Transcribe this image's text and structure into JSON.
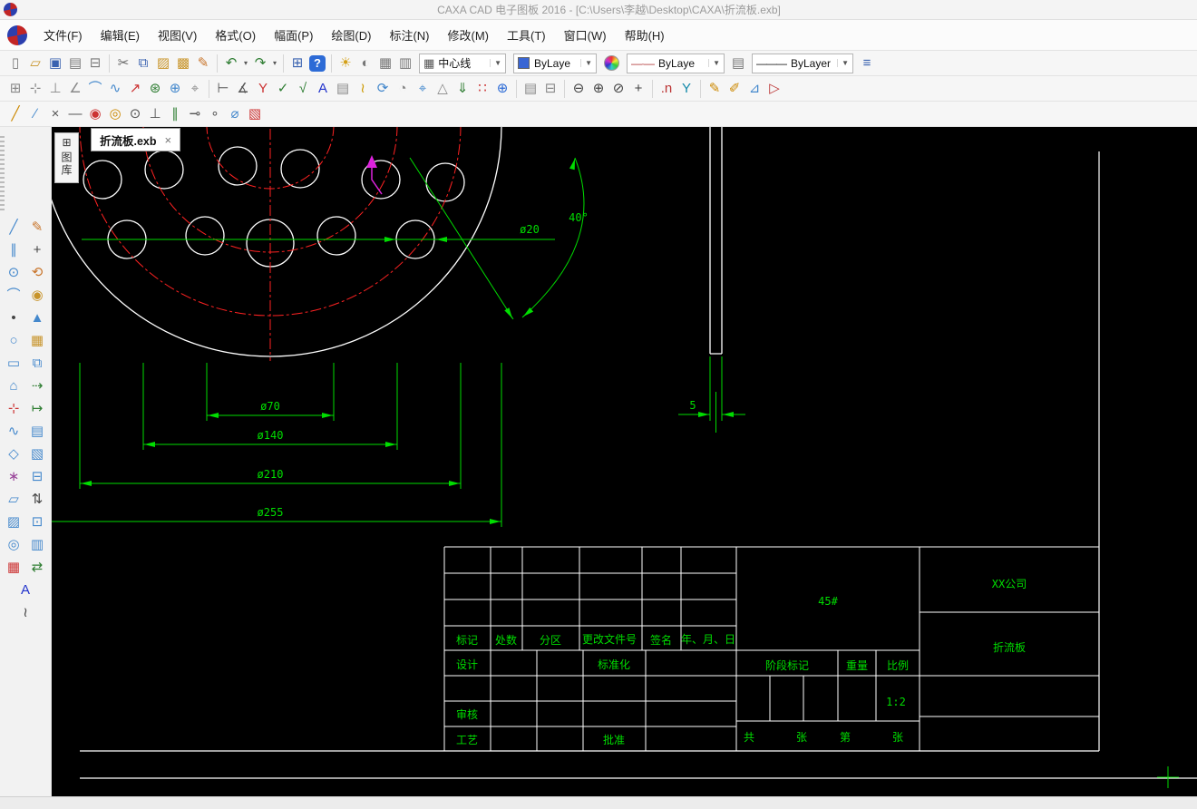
{
  "window": {
    "title": "CAXA CAD 电子图板 2016 - [C:\\Users\\李越\\Desktop\\CAXA\\折流板.exb]"
  },
  "menu": {
    "items": [
      "文件(F)",
      "编辑(E)",
      "视图(V)",
      "格式(O)",
      "幅面(P)",
      "绘图(D)",
      "标注(N)",
      "修改(M)",
      "工具(T)",
      "窗口(W)",
      "帮助(H)"
    ]
  },
  "toolbar1": {
    "layer_value": "中心线",
    "color_value": "ByLaye",
    "linetype_value": "ByLaye",
    "lineweight_value": "ByLayer",
    "linetype_glyph": "—·—",
    "lineweight_glyph": "———",
    "icons": [
      {
        "n": "new-file-icon",
        "g": "▯",
        "c": "#7a7a7a"
      },
      {
        "n": "open-file-icon",
        "g": "▱",
        "c": "#c8942a"
      },
      {
        "n": "save-icon",
        "g": "▣",
        "c": "#3a62b0"
      },
      {
        "n": "print-preview-icon",
        "g": "▤",
        "c": "#7a7a7a"
      },
      {
        "n": "print-icon",
        "g": "⊟",
        "c": "#7a7a7a"
      },
      {
        "sep": true
      },
      {
        "n": "cut-icon",
        "g": "✂",
        "c": "#666666"
      },
      {
        "n": "copy-icon",
        "g": "⧉",
        "c": "#3a62b0"
      },
      {
        "n": "paste-icon",
        "g": "▨",
        "c": "#c8942a"
      },
      {
        "n": "paste-special-icon",
        "g": "▩",
        "c": "#c8942a"
      },
      {
        "n": "format-brush-icon",
        "g": "✎",
        "c": "#c8742a"
      },
      {
        "sep": true
      },
      {
        "n": "undo-icon",
        "g": "↶",
        "c": "#2e7d32"
      },
      {
        "n": "undo-dropdown-icon",
        "g": "▾",
        "c": "#555555",
        "small": true
      },
      {
        "n": "redo-icon",
        "g": "↷",
        "c": "#2e7d32"
      },
      {
        "n": "redo-dropdown-icon",
        "g": "▾",
        "c": "#555555",
        "small": true
      },
      {
        "sep": true
      },
      {
        "n": "ole-object-icon",
        "g": "⊞",
        "c": "#3a62b0"
      },
      {
        "n": "help-icon",
        "g": "?",
        "c": "#ffffff",
        "bg": "#2d6bd6"
      }
    ],
    "layer_icons": [
      {
        "n": "layer-visibility-icon",
        "g": "☀",
        "c": "#d4a017"
      },
      {
        "n": "layer-state-icon",
        "g": "◐",
        "c": "#777777"
      },
      {
        "n": "layer-manager-icon",
        "g": "▦",
        "c": "#777777"
      },
      {
        "n": "layer-tool-icon",
        "g": "▥",
        "c": "#777777"
      }
    ],
    "combo_layer_icon": {
      "g": "▦",
      "c": "#555555"
    },
    "after_linetype_icons": [
      {
        "n": "linetype-manager-icon",
        "g": "▤",
        "c": "#777777"
      }
    ],
    "after_lineweight_icons": [
      {
        "n": "lineweight-manager-icon",
        "g": "≡",
        "c": "#3a62b0"
      }
    ]
  },
  "toolbar2": {
    "icons": [
      {
        "n": "grid-snap-icon",
        "g": "⊞",
        "c": "#888888"
      },
      {
        "n": "snap-point-icon",
        "g": "⊹",
        "c": "#888888"
      },
      {
        "n": "ortho-icon",
        "g": "⊥",
        "c": "#888888"
      },
      {
        "n": "polar-icon",
        "g": "∠",
        "c": "#888888"
      },
      {
        "n": "arc-tool-icon",
        "g": "⌒",
        "c": "#4488cc"
      },
      {
        "n": "spline-tool-icon",
        "g": "∿",
        "c": "#4488cc"
      },
      {
        "n": "arrow-tool-icon",
        "g": "↗",
        "c": "#cc3333"
      },
      {
        "n": "break-icon",
        "g": "⊛",
        "c": "#2e7d32"
      },
      {
        "n": "insert-icon",
        "g": "⊕",
        "c": "#4488cc"
      },
      {
        "n": "locate-icon",
        "g": "⌖",
        "c": "#888888"
      },
      {
        "sep": true
      },
      {
        "n": "linear-dim-icon",
        "g": "⊢",
        "c": "#555555"
      },
      {
        "n": "angle-dim-icon",
        "g": "∡",
        "c": "#555555"
      },
      {
        "n": "leader-icon",
        "g": "Y",
        "c": "#cc3333"
      },
      {
        "n": "datum-icon",
        "g": "✓",
        "c": "#2e7d32"
      },
      {
        "n": "tolerance-icon",
        "g": "√",
        "c": "#2e7d32"
      },
      {
        "n": "text-tool-icon",
        "g": "A",
        "c": "#2233cc"
      },
      {
        "n": "image-icon",
        "g": "▤",
        "c": "#888888"
      },
      {
        "n": "explode-icon",
        "g": "≀",
        "c": "#cc9900"
      },
      {
        "n": "rotate-view-icon",
        "g": "⟳",
        "c": "#4488cc"
      },
      {
        "n": "regen-icon",
        "g": "◔",
        "c": "#888888"
      },
      {
        "n": "center-mark-icon",
        "g": "⌖",
        "c": "#4488cc"
      },
      {
        "n": "triangle-tool-icon",
        "g": "△",
        "c": "#888888"
      },
      {
        "n": "download-style-icon",
        "g": "⇓",
        "c": "#2e7d32"
      },
      {
        "n": "array-icon",
        "g": "∷",
        "c": "#cc3333"
      },
      {
        "n": "sphere-icon",
        "g": "⊕",
        "c": "#2d6bd6"
      },
      {
        "sep": true
      },
      {
        "n": "bom-table-icon",
        "g": "▤",
        "c": "#888888"
      },
      {
        "n": "table-icon",
        "g": "⊟",
        "c": "#888888"
      },
      {
        "sep": true
      },
      {
        "n": "zoom-out-icon",
        "g": "⊖",
        "c": "#444444"
      },
      {
        "n": "zoom-in-icon",
        "g": "⊕",
        "c": "#444444"
      },
      {
        "n": "zoom-window-icon",
        "g": "⊘",
        "c": "#444444"
      },
      {
        "n": "pan-icon",
        "g": "+",
        "c": "#444444"
      },
      {
        "sep": true
      },
      {
        "n": "name-filter-icon",
        "g": ".n",
        "c": "#bb3333"
      },
      {
        "n": "quick-select-icon",
        "g": "Y",
        "c": "#1188aa"
      },
      {
        "sep": true
      },
      {
        "n": "style-brush-icon",
        "g": "✎",
        "c": "#cc8800"
      },
      {
        "n": "property-brush-icon",
        "g": "✐",
        "c": "#cc8800"
      },
      {
        "n": "measure-icon",
        "g": "⊿",
        "c": "#4488cc"
      },
      {
        "n": "flag-icon",
        "g": "▷",
        "c": "#bb3333"
      }
    ]
  },
  "toolbar3": {
    "icons": [
      {
        "n": "line-tool-icon",
        "g": "╱",
        "c": "#cc8800"
      },
      {
        "n": "angle-line-icon",
        "g": "∕",
        "c": "#4488cc"
      },
      {
        "n": "two-point-line-icon",
        "g": "×",
        "c": "#555555"
      },
      {
        "n": "horizontal-line-icon",
        "g": "—",
        "c": "#555555"
      },
      {
        "n": "center-circle-icon",
        "g": "◉",
        "c": "#cc3333"
      },
      {
        "n": "two-point-circle-icon",
        "g": "◎",
        "c": "#cc8800"
      },
      {
        "n": "three-point-circle-icon",
        "g": "⊙",
        "c": "#555555"
      },
      {
        "n": "perpendicular-icon",
        "g": "⊥",
        "c": "#555555"
      },
      {
        "n": "parallel-icon",
        "g": "∥",
        "c": "#2e7d32"
      },
      {
        "n": "tangent-icon",
        "g": "⊸",
        "c": "#555555"
      },
      {
        "n": "point-tool-icon",
        "g": "∘",
        "c": "#555555"
      },
      {
        "n": "diameter-icon",
        "g": "⌀",
        "c": "#4488cc"
      },
      {
        "n": "hatch-red-icon",
        "g": "▧",
        "c": "#cc3333"
      }
    ]
  },
  "left_toolbar": {
    "rows": [
      [
        {
          "n": "line-tool-icon",
          "g": "╱",
          "c": "#4488cc"
        },
        {
          "n": "brush-tool-icon",
          "g": "✎",
          "c": "#c8742a"
        }
      ],
      [
        {
          "n": "parallel-line-icon",
          "g": "∥",
          "c": "#4488cc"
        },
        {
          "n": "move-tool-icon",
          "g": "+",
          "c": "#444444"
        }
      ],
      [
        {
          "n": "circle-tool-icon",
          "g": "⊙",
          "c": "#4488cc"
        },
        {
          "n": "rotate-tool-icon",
          "g": "⟲",
          "c": "#c8742a"
        }
      ],
      [
        {
          "n": "arc-tool-icon",
          "g": "⌒",
          "c": "#4488cc"
        },
        {
          "n": "target-circle-icon",
          "g": "◉",
          "c": "#c8942a"
        }
      ],
      [
        {
          "n": "point-tool-icon",
          "g": "•",
          "c": "#444444"
        },
        {
          "n": "mirror-tool-icon",
          "g": "▲",
          "c": "#4488cc"
        }
      ],
      [
        {
          "n": "ellipse-tool-icon",
          "g": "○",
          "c": "#4488cc"
        },
        {
          "n": "array-tool-icon",
          "g": "▦",
          "c": "#c8942a"
        }
      ],
      [
        {
          "n": "rectangle-tool-icon",
          "g": "▭",
          "c": "#4488cc"
        },
        {
          "n": "copy-shape-icon",
          "g": "⧉",
          "c": "#4488cc"
        }
      ],
      [
        {
          "n": "polygon-tool-icon",
          "g": "⌂",
          "c": "#4488cc"
        },
        {
          "n": "offset-icon",
          "g": "⇢",
          "c": "#2e7d32"
        }
      ],
      [
        {
          "n": "centerline-tool-icon",
          "g": "⊹",
          "c": "#cc3333"
        },
        {
          "n": "extend-icon",
          "g": "↦",
          "c": "#2e7d32"
        }
      ],
      [
        {
          "n": "spline-tool-icon",
          "g": "∿",
          "c": "#4488cc"
        },
        {
          "n": "image-panel-icon",
          "g": "▤",
          "c": "#4488cc"
        }
      ],
      [
        {
          "n": "polyline-tool-icon",
          "g": "◇",
          "c": "#4488cc"
        },
        {
          "n": "hatch-tool-icon",
          "g": "▧",
          "c": "#4488cc"
        }
      ],
      [
        {
          "n": "formula-tool-icon",
          "g": "∗",
          "c": "#994499"
        },
        {
          "n": "table-tool-icon",
          "g": "⊟",
          "c": "#4488cc"
        }
      ],
      [
        {
          "n": "sketch-tool-icon",
          "g": "▱",
          "c": "#4488cc"
        },
        {
          "n": "stretch-icon",
          "g": "⇅",
          "c": "#444444"
        }
      ],
      [
        {
          "n": "fill-tool-icon",
          "g": "▨",
          "c": "#4488cc"
        },
        {
          "n": "block-icon",
          "g": "⊡",
          "c": "#4488cc"
        }
      ],
      [
        {
          "n": "ring-tool-icon",
          "g": "◎",
          "c": "#4488cc"
        },
        {
          "n": "list-icon",
          "g": "▥",
          "c": "#4488cc"
        }
      ],
      [
        {
          "n": "grid-red-icon",
          "g": "▦",
          "c": "#cc3333"
        },
        {
          "n": "swap-icon",
          "g": "⇄",
          "c": "#2e7d32"
        }
      ],
      [
        {
          "n": "text-tool-icon",
          "g": "A",
          "c": "#2233cc"
        }
      ],
      [
        {
          "n": "wave-tool-icon",
          "g": "≀",
          "c": "#444444"
        }
      ]
    ]
  },
  "doc_tab": {
    "label": "折流板.exb",
    "close": "×"
  },
  "side_tab": {
    "label": "图库",
    "icon": "⊞"
  },
  "drawing": {
    "dims": {
      "d70": "ø70",
      "d140": "ø140",
      "d210": "ø210",
      "d255": "ø255",
      "d20": "ø20",
      "a40": "40°",
      "t5": "5"
    },
    "title_block": {
      "header_cells": [
        "标记",
        "处数",
        "分区",
        "更改文件号",
        "签名",
        "年、月、日"
      ],
      "design_label": "设计",
      "standardize_label": "标准化",
      "review_label": "审核",
      "process_label": "工艺",
      "approve_label": "批准",
      "material": "45#",
      "stage_label": "阶段标记",
      "weight_label": "重量",
      "scale_label": "比例",
      "scale_value": "1:2",
      "sheet_total_label": "共",
      "sheet_unit_label": "张",
      "sheet_no_label": "第",
      "sheet_unit_label2": "张",
      "company": "XX公司",
      "part_name": "折流板"
    },
    "colors": {
      "geometry": "#ffffff",
      "centerline": "#ff2222",
      "dimension": "#00dd00",
      "highlight": "#dd22dd"
    }
  }
}
